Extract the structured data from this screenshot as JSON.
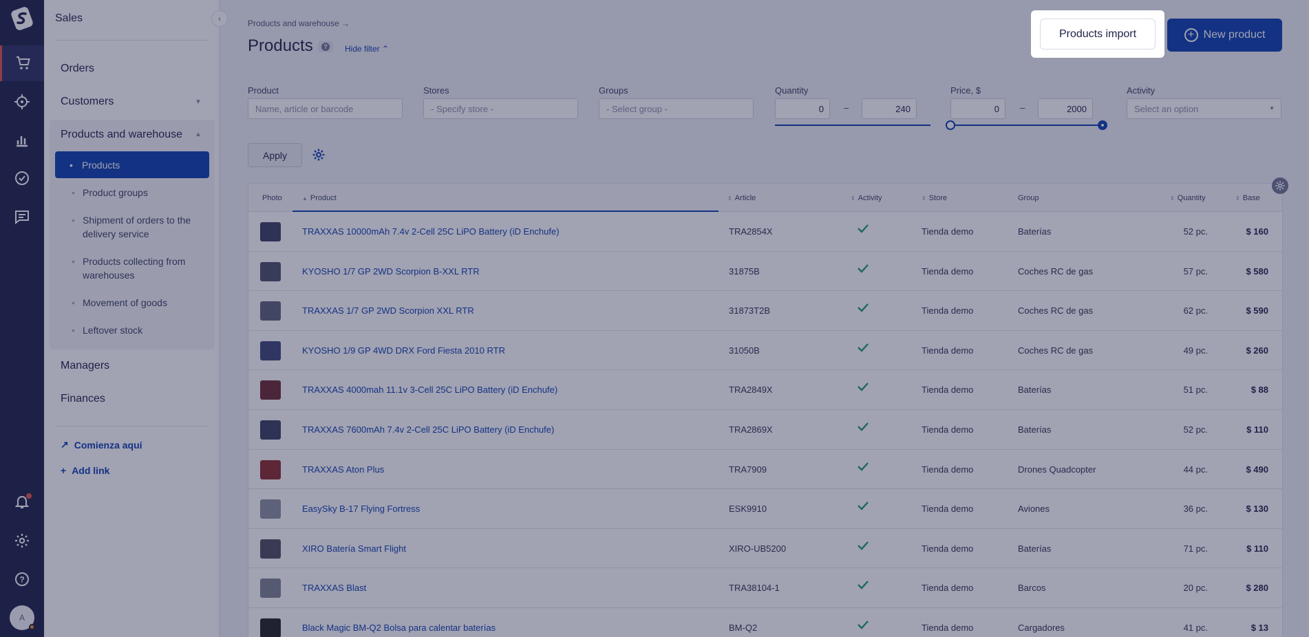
{
  "sidebar": {
    "section_title": "Sales",
    "nav": {
      "orders": "Orders",
      "customers": "Customers",
      "products_warehouse": "Products and warehouse",
      "managers": "Managers",
      "finances": "Finances"
    },
    "sub_items": [
      "Products",
      "Product groups",
      "Shipment of orders to the delivery service",
      "Products collecting from warehouses",
      "Movement of goods",
      "Leftover stock"
    ],
    "links": {
      "start": "Comienza aquí",
      "add": "Add link"
    }
  },
  "avatar": {
    "initial": "A"
  },
  "header": {
    "breadcrumb": "Products and warehouse →",
    "title": "Products",
    "help": "?",
    "hide_filter": "Hide filter",
    "import_label": "Products import",
    "new_label": "New product"
  },
  "filters": {
    "product": {
      "label": "Product",
      "placeholder": "Name, article or barcode"
    },
    "stores": {
      "label": "Stores",
      "placeholder": "- Specify store -"
    },
    "groups": {
      "label": "Groups",
      "placeholder": "- Select group -"
    },
    "quantity": {
      "label": "Quantity",
      "min": "0",
      "max": "240"
    },
    "price": {
      "label": "Price, $",
      "min": "0",
      "max": "2000"
    },
    "activity": {
      "label": "Activity",
      "placeholder": "Select an option"
    },
    "dash": "–",
    "apply": "Apply"
  },
  "table": {
    "columns": {
      "photo": "Photo",
      "product": "Product",
      "article": "Article",
      "activity": "Activity",
      "store": "Store",
      "group": "Group",
      "quantity": "Quantity",
      "base": "Base"
    },
    "rows": [
      {
        "name": "TRAXXAS 10000mAh 7.4v 2-Cell 25C LiPO Battery (iD Enchufe)",
        "article": "TRA2854X",
        "store": "Tienda demo",
        "group": "Baterías",
        "qty": "52 pc.",
        "base": "$ 160"
      },
      {
        "name": "KYOSHO 1/7 GP 2WD Scorpion B-XXL RTR",
        "article": "31875B",
        "store": "Tienda demo",
        "group": "Coches RC de gas",
        "qty": "57 pc.",
        "base": "$ 580"
      },
      {
        "name": "TRAXXAS 1/7 GP 2WD Scorpion XXL RTR",
        "article": "31873T2B",
        "store": "Tienda demo",
        "group": "Coches RC de gas",
        "qty": "62 pc.",
        "base": "$ 590"
      },
      {
        "name": "KYOSHO 1/9 GP 4WD DRX Ford Fiesta 2010 RTR",
        "article": "31050B",
        "store": "Tienda demo",
        "group": "Coches RC de gas",
        "qty": "49 pc.",
        "base": "$ 260"
      },
      {
        "name": "TRAXXAS 4000mah 11.1v 3-Cell 25C LiPO Battery (iD Enchufe)",
        "article": "TRA2849X",
        "store": "Tienda demo",
        "group": "Baterías",
        "qty": "51 pc.",
        "base": "$ 88"
      },
      {
        "name": "TRAXXAS 7600mAh 7.4v 2-Cell 25C LiPO Battery (iD Enchufe)",
        "article": "TRA2869X",
        "store": "Tienda demo",
        "group": "Baterías",
        "qty": "52 pc.",
        "base": "$ 110"
      },
      {
        "name": "TRAXXAS Aton Plus",
        "article": "TRA7909",
        "store": "Tienda demo",
        "group": "Drones Quadcopter",
        "qty": "44 pc.",
        "base": "$ 490"
      },
      {
        "name": "EasySky B-17 Flying Fortress",
        "article": "ESK9910",
        "store": "Tienda demo",
        "group": "Aviones",
        "qty": "36 pc.",
        "base": "$ 130"
      },
      {
        "name": "XIRO Batería Smart Flight",
        "article": "XIRO-UB5200",
        "store": "Tienda demo",
        "group": "Baterías",
        "qty": "71 pc.",
        "base": "$ 110"
      },
      {
        "name": "TRAXXAS Blast",
        "article": "TRA38104-1",
        "store": "Tienda demo",
        "group": "Barcos",
        "qty": "20 pc.",
        "base": "$ 280"
      },
      {
        "name": "Black Magic BM-Q2 Bolsa para calentar baterías",
        "article": "BM-Q2",
        "store": "Tienda demo",
        "group": "Cargadores",
        "qty": "41 pc.",
        "base": "$ 13"
      }
    ]
  },
  "colors": {
    "brand": "#0b3eaf",
    "rail": "#1e2248",
    "active_check": "#1f9a6d",
    "notification": "#e0524a"
  }
}
